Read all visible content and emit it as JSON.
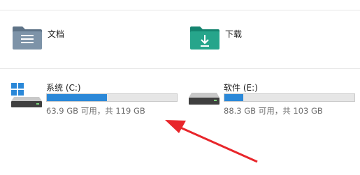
{
  "folders": [
    {
      "label": "文档",
      "icon": "documents-folder-icon"
    },
    {
      "label": "下载",
      "icon": "downloads-folder-icon"
    }
  ],
  "drives": [
    {
      "name": "系统 (C:)",
      "info": "63.9 GB 可用，共 119 GB",
      "used_fraction": 0.463,
      "icon": "system-drive-icon",
      "has_windows_logo": true
    },
    {
      "name": "软件 (E:)",
      "info": "88.3 GB 可用，共 103 GB",
      "used_fraction": 0.143,
      "icon": "drive-icon",
      "has_windows_logo": false
    }
  ],
  "colors": {
    "accent": "#2b88d8",
    "bar_background": "#e6e6e6",
    "annotation_arrow": "#e8262b"
  }
}
